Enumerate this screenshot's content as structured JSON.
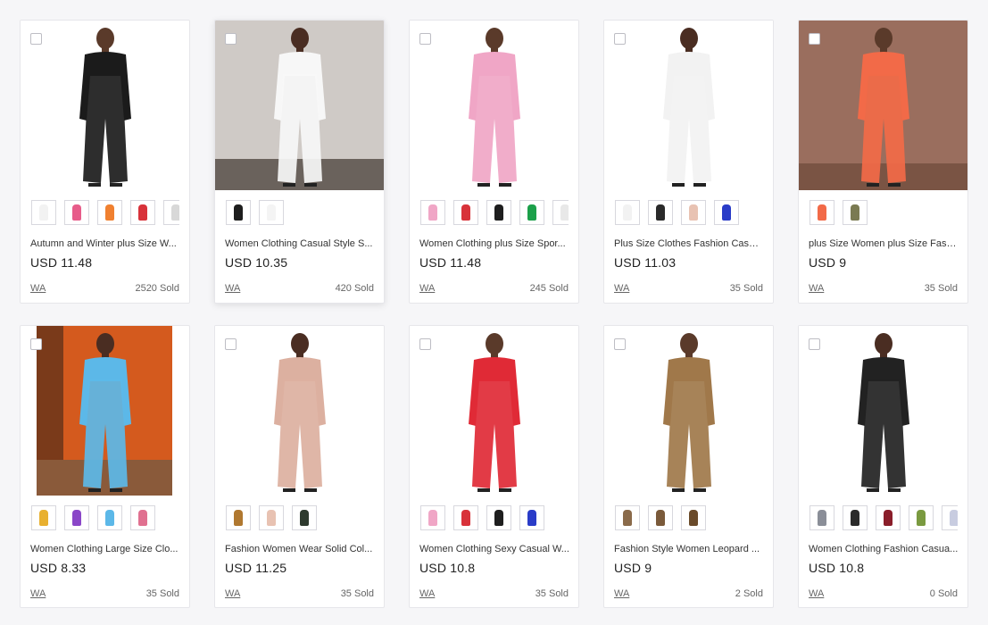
{
  "products": [
    {
      "title": "Autumn and Winter plus Size W...",
      "price": "USD 11.48",
      "store": "WA",
      "sold": "2520 Sold",
      "bg": "#ffffff",
      "garment": "#1b1b1b",
      "skin": "#5a3a2a",
      "photo": "studio",
      "swatches": [
        "#f2f2f2",
        "#e75c8a",
        "#f08030",
        "#d8323a",
        "#d8d8d8"
      ]
    },
    {
      "title": "Women Clothing Casual Style S...",
      "price": "USD 10.35",
      "store": "WA",
      "sold": "420 Sold",
      "bg": "#cfcac6",
      "garment": "#f7f7f7",
      "skin": "#4a2d22",
      "photo": "room",
      "swatches": [
        "#1e1e1e",
        "#f4f4f4"
      ]
    },
    {
      "title": "Women Clothing plus Size Spor...",
      "price": "USD 11.48",
      "store": "WA",
      "sold": "245 Sold",
      "bg": "#ffffff",
      "garment": "#f0a6c6",
      "skin": "#5a3a2a",
      "photo": "studio",
      "swatches": [
        "#f0a6c6",
        "#d8323a",
        "#1e1e1e",
        "#1ca04a",
        "#e8e8e8"
      ]
    },
    {
      "title": "Plus Size Clothes Fashion Casua...",
      "price": "USD 11.03",
      "store": "WA",
      "sold": "35 Sold",
      "bg": "#ffffff",
      "garment": "#f2f2f2",
      "skin": "#4a2d22",
      "photo": "studio",
      "swatches": [
        "#f2f2f2",
        "#2a2a2a",
        "#e8c2b2",
        "#2a3cc8"
      ]
    },
    {
      "title": "plus Size Women plus Size Fash...",
      "price": "USD 9",
      "store": "WA",
      "sold": "35 Sold",
      "bg": "#9a6e5e",
      "garment": "#f26a48",
      "skin": "#5a3a2a",
      "photo": "wall",
      "swatches": [
        "#f26a48",
        "#7a7a52"
      ]
    },
    {
      "title": "Women Clothing Large Size Clo...",
      "price": "USD 8.33",
      "store": "WA",
      "sold": "35 Sold",
      "bg": "#d45a1e",
      "garment": "#5cb8e8",
      "skin": "#4a2d22",
      "photo": "orange",
      "swatches": [
        "#e8b030",
        "#8a46c8",
        "#5cb8e8",
        "#e07090"
      ]
    },
    {
      "title": "Fashion Women Wear Solid Col...",
      "price": "USD 11.25",
      "store": "WA",
      "sold": "35 Sold",
      "bg": "#ffffff",
      "garment": "#dcb0a0",
      "skin": "#4a2d22",
      "photo": "studio",
      "swatches": [
        "#b07830",
        "#e8c2b2",
        "#2e3a2e"
      ]
    },
    {
      "title": "Women Clothing Sexy Casual W...",
      "price": "USD 10.8",
      "store": "WA",
      "sold": "35 Sold",
      "bg": "#ffffff",
      "garment": "#e02a36",
      "skin": "#5a3a2a",
      "photo": "studio",
      "swatches": [
        "#f0a6c6",
        "#d8323a",
        "#1e1e1e",
        "#2a3cc8"
      ]
    },
    {
      "title": "Fashion Style Women Leopard ...",
      "price": "USD 9",
      "store": "WA",
      "sold": "2 Sold",
      "bg": "#ffffff",
      "garment": "#a0784a",
      "skin": "#5a3a2a",
      "photo": "studio",
      "swatches": [
        "#8a6a4a",
        "#7a5a3a",
        "#6a4a2a"
      ]
    },
    {
      "title": "Women Clothing Fashion Casua...",
      "price": "USD 10.8",
      "store": "WA",
      "sold": "0 Sold",
      "bg": "#ffffff",
      "garment": "#222222",
      "skin": "#4a2d22",
      "photo": "studio",
      "swatches": [
        "#8a8e98",
        "#2a2a2a",
        "#8a1e2a",
        "#7a9a40",
        "#c8cce0"
      ]
    }
  ]
}
